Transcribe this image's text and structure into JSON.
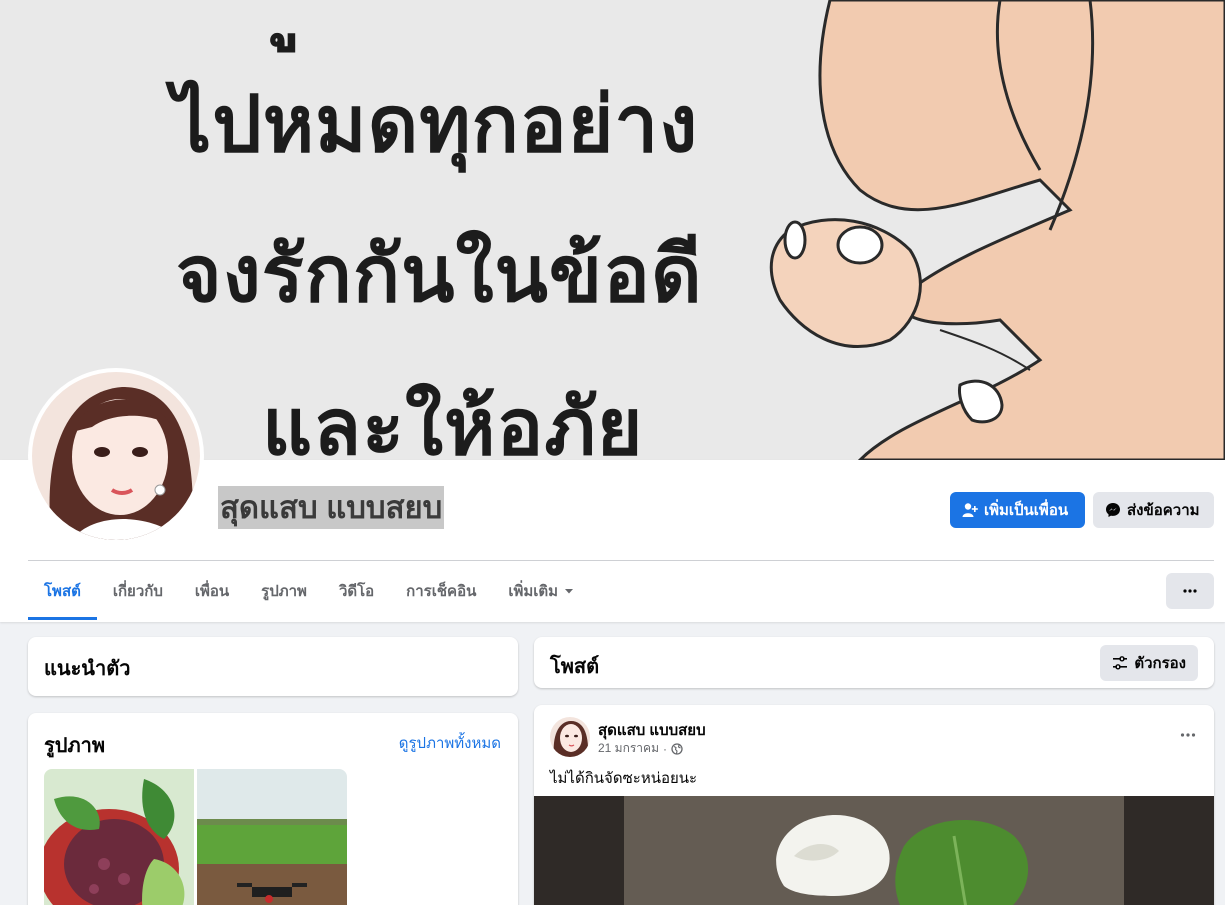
{
  "cover": {
    "lines": [
      "ู",
      "ไปหมดทุกอย่าง",
      "จงรักกันในข้อดี",
      "และให้อภัย"
    ]
  },
  "profile": {
    "name": "สุดแสบ แบบสยบ",
    "add_friend_label": "เพิ่มเป็นเพื่อน",
    "message_label": "ส่งข้อความ"
  },
  "tabs": [
    {
      "label": "โพสต์",
      "active": true
    },
    {
      "label": "เกี่ยวกับ",
      "active": false
    },
    {
      "label": "เพื่อน",
      "active": false
    },
    {
      "label": "รูปภาพ",
      "active": false
    },
    {
      "label": "วิดีโอ",
      "active": false
    },
    {
      "label": "การเช็คอิน",
      "active": false
    },
    {
      "label": "เพิ่มเติม",
      "active": false
    }
  ],
  "intro": {
    "title": "แนะนำตัว"
  },
  "photos": {
    "title": "รูปภาพ",
    "see_all": "ดูรูปภาพทั้งหมด"
  },
  "posts": {
    "title": "โพสต์",
    "filter_label": "ตัวกรอง"
  },
  "post": {
    "author": "สุดแสบ แบบสยบ",
    "date": "21 มกราคม",
    "separator": "·",
    "text": "ไม่ได้กินจัดซะหน่อยนะ"
  },
  "colors": {
    "accent": "#1b74e4",
    "background": "#f0f2f5",
    "secondary_button": "#e4e6eb"
  }
}
